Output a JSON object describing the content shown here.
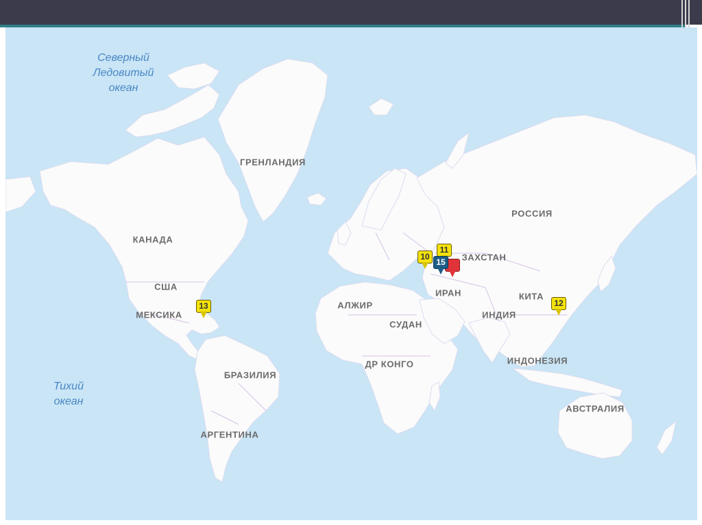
{
  "map": {
    "colors": {
      "water": "#c9e5f6",
      "land": "#fbfbfb",
      "borders": "#d4c2e6",
      "labels": "#6b6b6b",
      "oceans": "#4a86c4"
    },
    "oceans": {
      "arctic": [
        "Северный",
        "Ледовитый",
        "океан"
      ],
      "pacific": [
        "Тихий",
        "океан"
      ]
    },
    "countries": {
      "greenland": "ГРЕНЛАНДИЯ",
      "canada": "КАНАДА",
      "usa": "США",
      "mexico": "МЕКСИКА",
      "brazil": "БРАЗИЛИЯ",
      "argentina": "АРГЕНТИНА",
      "russia": "РОССИЯ",
      "kazakhstan": "ЗАХСТАН",
      "algeria": "АЛЖИР",
      "sudan": "СУДАН",
      "iran": "ИРАН",
      "india": "ИНДИЯ",
      "china": "КИТА",
      "dr_congo": "ДР КОНГО",
      "indonesia": "ИНДОНЕЗИЯ",
      "australia": "АВСТРАЛИЯ"
    },
    "markers": [
      {
        "id": "marker-usa",
        "label": "13",
        "color": "yellow"
      },
      {
        "id": "marker-caspian-10",
        "label": "10",
        "color": "yellow"
      },
      {
        "id": "marker-caspian-11",
        "label": "11",
        "color": "yellow"
      },
      {
        "id": "marker-caspian-15",
        "label": "15",
        "color": "blue"
      },
      {
        "id": "marker-caspian-red",
        "label": "",
        "color": "red"
      },
      {
        "id": "marker-china",
        "label": "12",
        "color": "yellow"
      }
    ]
  }
}
